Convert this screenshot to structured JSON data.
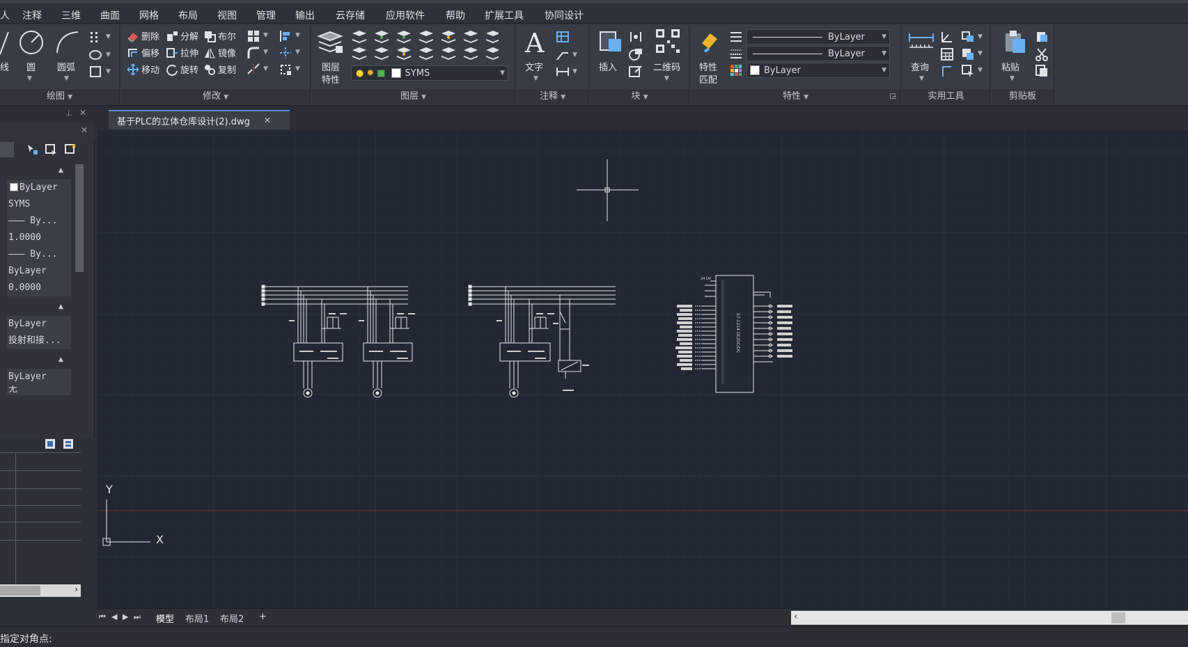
{
  "menu": {
    "items": [
      "注释",
      "三维",
      "曲面",
      "网格",
      "布局",
      "视图",
      "管理",
      "输出",
      "云存储",
      "应用软件",
      "帮助",
      "扩展工具",
      "协同设计"
    ]
  },
  "ribbon": {
    "draw": {
      "title": "绘图",
      "line": "线",
      "circle": "圆",
      "arc": "圆弧"
    },
    "modify": {
      "title": "修改",
      "delete": "删除",
      "explode": "分解",
      "boolean": "布尔",
      "offset": "偏移",
      "stretch": "拉伸",
      "mirror": "镜像",
      "move": "移动",
      "rotate": "旋转",
      "copy": "复制"
    },
    "layers": {
      "title": "图层",
      "props_line1": "图层",
      "props_line2": "特性",
      "current_layer": "SYMS"
    },
    "annotation": {
      "title": "注释",
      "text": "文字"
    },
    "block": {
      "title": "块",
      "insert": "插入",
      "qrcode": "二维码"
    },
    "properties": {
      "title": "特性",
      "match_line1": "特性",
      "match_line2": "匹配",
      "linetype": "ByLayer",
      "lineweight": "ByLayer",
      "color": "ByLayer"
    },
    "utilities": {
      "title": "实用工具",
      "query": "查询"
    },
    "clipboard": {
      "title": "剪贴板",
      "paste": "粘贴"
    }
  },
  "left_panel": {
    "rows": [
      "ByLayer",
      "SYMS",
      "——— By...",
      "1.0000",
      "——— By...",
      "ByLayer",
      "0.0000",
      "ByLayer",
      "投射和接...",
      "ByLayer",
      "无"
    ]
  },
  "document": {
    "tab_title": "基于PLC的立体仓库设计(2).dwg"
  },
  "canvas": {
    "background": "#212832",
    "grid_color": "#2b3340",
    "drawing_color": "#e8e8e8",
    "x_axis_label": "X",
    "y_axis_label": "Y",
    "plc_label": "S7-1214 DC/DC/DC",
    "plc_supply_label": "24 DV"
  },
  "layout_tabs": {
    "model": "模型",
    "layout1": "布局1",
    "layout2": "布局2",
    "add": "+"
  },
  "status": {
    "command_prompt": "指定对角点:"
  }
}
